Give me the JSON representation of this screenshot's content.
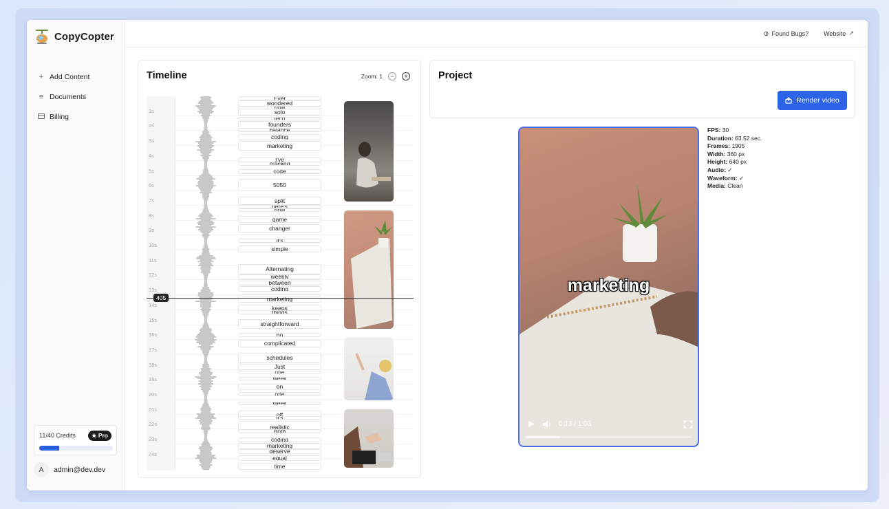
{
  "brand": {
    "name": "CopyCopter",
    "logo_icon": "helicopter-logo"
  },
  "sidebar": {
    "items": [
      {
        "label": "Add Content",
        "icon": "plus-icon"
      },
      {
        "label": "Documents",
        "icon": "list-icon"
      },
      {
        "label": "Billing",
        "icon": "credit-card-icon"
      }
    ],
    "credits": {
      "label": "11/40 Credits",
      "badge": "★ Pro",
      "fraction": 0.275
    },
    "user": {
      "initial": "A",
      "email": "admin@dev.dev"
    }
  },
  "topbar": {
    "found_bugs": "Found Bugs?",
    "website": "Website"
  },
  "timeline": {
    "title": "Timeline",
    "zoom_label": "Zoom: 1",
    "seconds": [
      "1s",
      "2s",
      "3s",
      "4s",
      "5s",
      "6s",
      "7s",
      "8s",
      "9s",
      "10s",
      "11s",
      "12s",
      "13s",
      "14s",
      "15s",
      "16s",
      "17s",
      "18s",
      "19s",
      "20s",
      "21s",
      "22s",
      "23s",
      "24s"
    ],
    "cursor_frame": "405",
    "words": [
      "Ever",
      "wondered",
      "how",
      "solo",
      "tech",
      "founders",
      "balance",
      "coding",
      "marketing",
      "I've",
      "cracked",
      "code",
      "5050",
      "split",
      "here's",
      "how",
      "game",
      "changer",
      "it's",
      "simple",
      "Alternating",
      "weekly",
      "between",
      "coding",
      "marketing",
      "keeps",
      "things",
      "straightforward",
      "no",
      "complicated",
      "schedules",
      "Just",
      "one",
      "week",
      "on",
      "one",
      "week",
      "off",
      "it's",
      "realistic",
      "Both",
      "coding",
      "marketing",
      "deserve",
      "equal",
      "time"
    ]
  },
  "project": {
    "title": "Project",
    "render_label": "Render video",
    "caption": "marketing",
    "time_display": "0:13 / 1:03",
    "progress_fraction": 0.205
  },
  "meta": [
    {
      "key": "FPS",
      "value": "30"
    },
    {
      "key": "Duration",
      "value": "63.52 sec."
    },
    {
      "key": "Frames",
      "value": "1905"
    },
    {
      "key": "Width",
      "value": "360 px"
    },
    {
      "key": "Height",
      "value": "640 px"
    },
    {
      "key": "Audio",
      "value": "✓"
    },
    {
      "key": "Waveform",
      "value": "✓"
    },
    {
      "key": "Media",
      "value": "Clean"
    }
  ],
  "colors": {
    "accent": "#2d63e6",
    "player_border": "#4a6ee8"
  }
}
